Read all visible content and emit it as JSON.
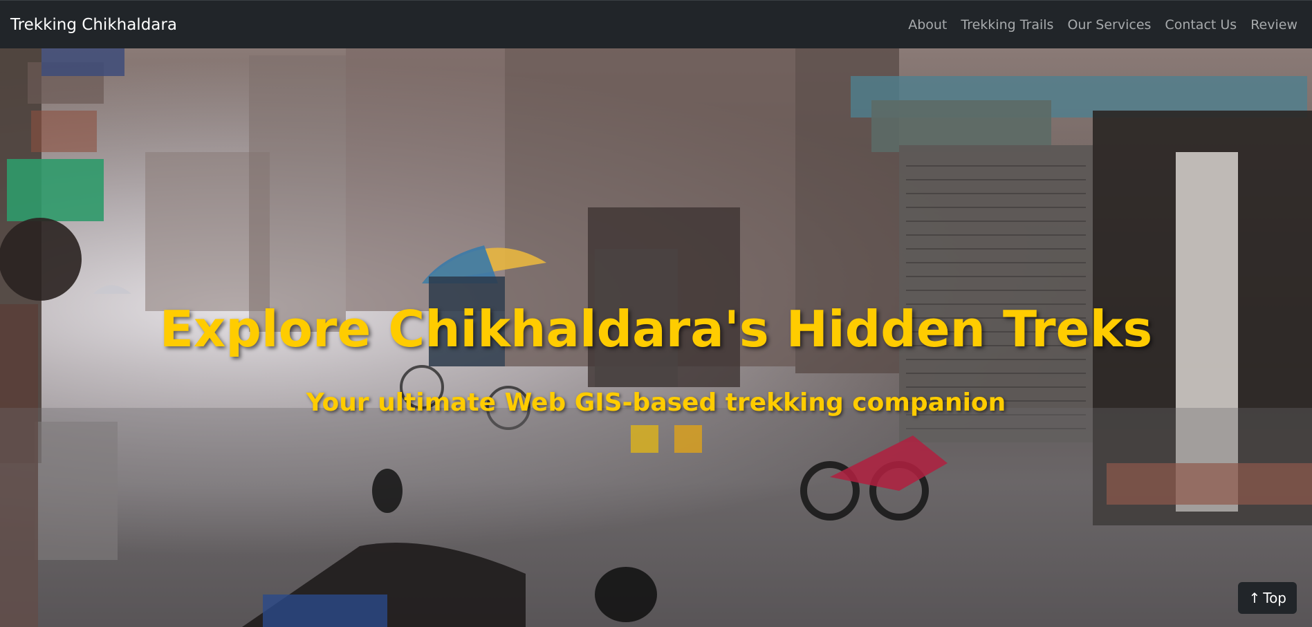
{
  "navbar": {
    "brand": "Trekking Chikhaldara",
    "links": [
      "About",
      "Trekking Trails",
      "Our Services",
      "Contact Us",
      "Review"
    ]
  },
  "hero": {
    "title": "Explore Chikhaldara's Hidden Treks",
    "subtitle": "Your ultimate Web GIS-based trekking companion"
  },
  "top_button": {
    "arrow": "↑",
    "label": "Top"
  },
  "colors": {
    "navbar_bg": "#212529",
    "accent_yellow": "#ffcc00",
    "nav_link": "#a8abad"
  }
}
